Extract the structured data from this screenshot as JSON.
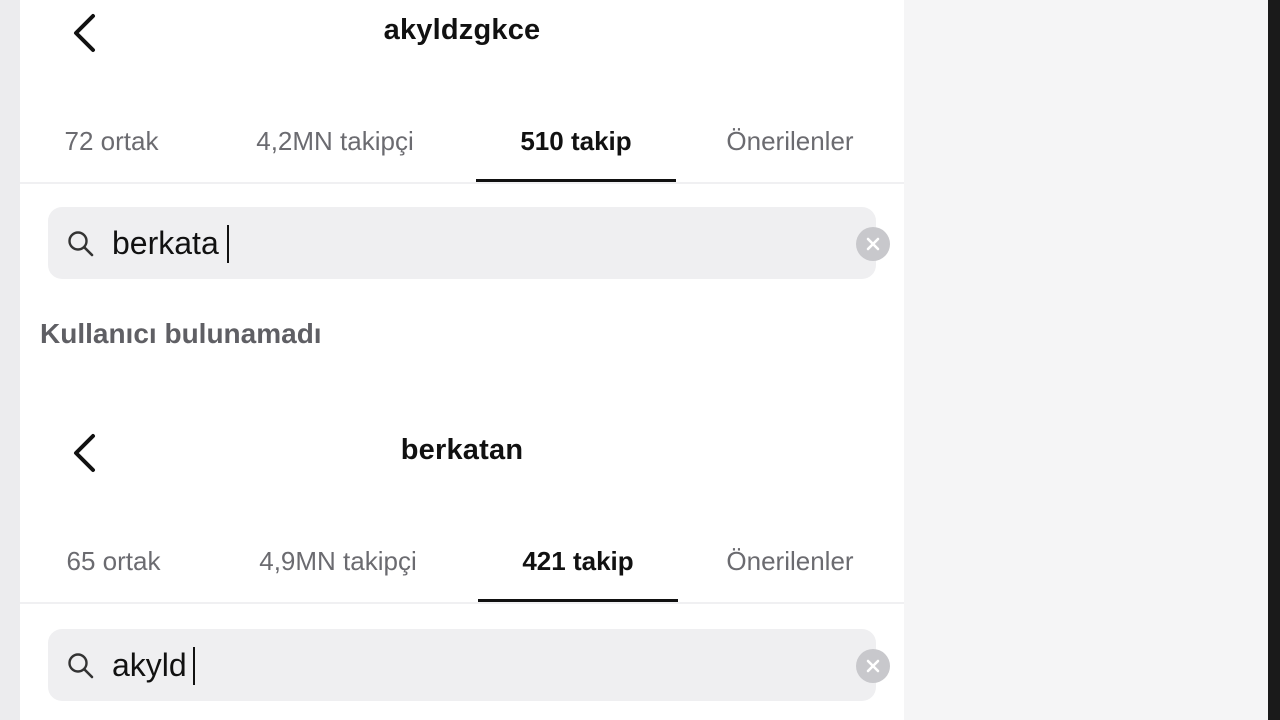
{
  "top_screen": {
    "title": "akyldzgkce",
    "tabs": [
      {
        "label": "72 ortak",
        "active": false
      },
      {
        "label": "4,2MN takipçi",
        "active": false
      },
      {
        "label": "510 takip",
        "active": true
      },
      {
        "label": "Önerilenler",
        "active": false
      }
    ],
    "search": {
      "value": "berkata",
      "clear_icon": "clear-icon",
      "search_icon": "search-icon"
    },
    "empty_message": "Kullanıcı bulunamadı"
  },
  "bottom_screen": {
    "title": "berkatan",
    "tabs": [
      {
        "label": "65 ortak",
        "active": false
      },
      {
        "label": "4,9MN takipçi",
        "active": false
      },
      {
        "label": "421 takip",
        "active": true
      },
      {
        "label": "Önerilenler",
        "active": false
      }
    ],
    "search": {
      "value": "akyld",
      "clear_icon": "clear-icon",
      "search_icon": "search-icon"
    }
  },
  "colors": {
    "active_tab": "#111111",
    "inactive_tab": "#6b6b70",
    "search_bg": "#efeff1",
    "clear_icon": "#c8c8cc"
  }
}
